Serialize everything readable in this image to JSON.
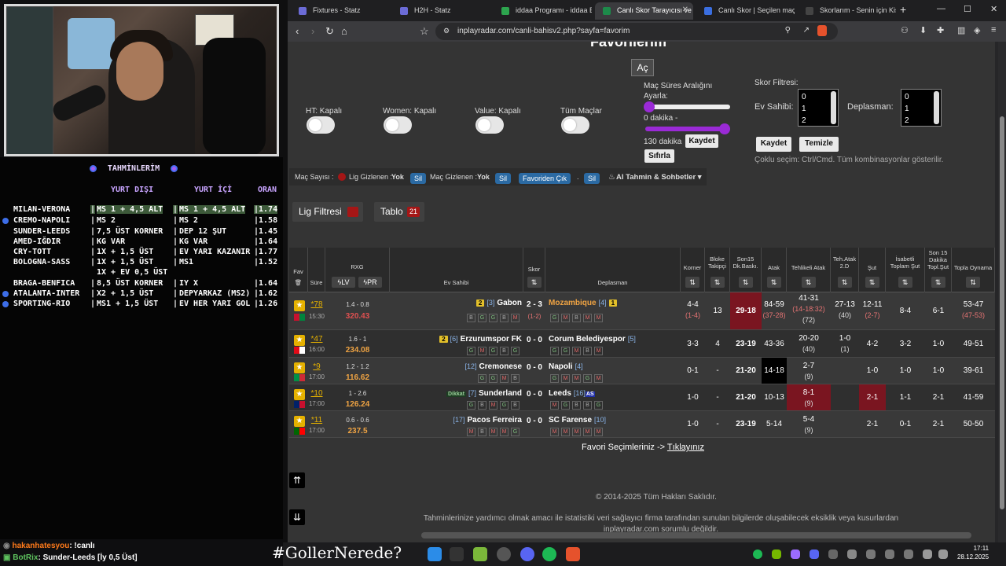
{
  "predictions": {
    "title": "TAHMİNLERİM",
    "headers": {
      "dis": "YURT DIŞI",
      "ic": "YURT İÇİ",
      "oran": "ORAN"
    },
    "rows": [
      {
        "match": "MILAN-VERONA",
        "dis": "MS 1 + 4,5 ALT",
        "ic": "MS 1 + 4,5 ALT",
        "oran": "|1.74",
        "hl": true,
        "bullet": false
      },
      {
        "match": "CREMO-NAPOLI",
        "dis": "MS 2",
        "ic": "MS 2",
        "oran": "|1.58",
        "hl": false,
        "bullet": true
      },
      {
        "match": "SUNDER-LEEDS",
        "dis": "7,5 ÜST KORNER",
        "ic": "DEP 12 ŞUT",
        "oran": "|1.45",
        "hl": false,
        "bullet": false
      },
      {
        "match": "AMED-IĞDIR",
        "dis": "KG VAR",
        "ic": "KG VAR",
        "oran": "|1.64",
        "hl": false,
        "bullet": false
      },
      {
        "match": "CRY-TOTT",
        "dis": "1X + 1,5 ÜST",
        "ic": "EV YARI KAZANIR",
        "oran": "|1.77",
        "hl": false,
        "bullet": false
      },
      {
        "match": "BOLOGNA-SASS",
        "dis": "1X + 1,5 ÜST",
        "ic": "MS1",
        "oran": "|1.52",
        "hl": false,
        "bullet": false
      },
      {
        "match": "",
        "dis": "1X + EV 0,5 ÜST",
        "ic": "",
        "oran": "",
        "hl": false,
        "bullet": false
      },
      {
        "match": "BRAGA-BENFICA",
        "dis": "8,5 ÜST KORNER",
        "ic": "IY X",
        "oran": "|1.64",
        "hl": false,
        "bullet": false
      },
      {
        "match": "ATALANTA-INTER",
        "dis": "X2 + 1,5 ÜST",
        "ic": "DEPYARKAZ (MS2)",
        "oran": "|1.62",
        "hl": false,
        "bullet": true
      },
      {
        "match": "SPORTING-RIO",
        "dis": "MS1 + 1,5 ÜST",
        "ic": "EV HER YARI GOL",
        "oran": "|1.26",
        "hl": false,
        "bullet": true
      }
    ]
  },
  "chat": [
    {
      "user": "hakanhatesyou",
      "msg": ": !canlı",
      "color": "#ff7a1a"
    },
    {
      "user": "BotRix",
      "msg": ": Sunder-Leeds [İy 0,5 Üst]",
      "color": "#5ec25e"
    }
  ],
  "browser": {
    "tabs": [
      "Fixtures - Statz",
      "H2H - Statz",
      "iddaa Programı - iddaa Bü",
      "Canlı Skor Tarayıcısı ve",
      "Canlı Skor | Seçilen maçlar",
      "Skorlarım - Senin için Kişise"
    ],
    "url": "inplayradar.com/canli-bahisv2.php?sayfa=favorim"
  },
  "page": {
    "title": "Favorilerim",
    "ac": "Aç",
    "toggles": [
      "HT: Kapalı",
      "Women: Kapalı",
      "Value: Kapalı",
      "Tüm Maçlar"
    ],
    "range_title": "Maç Süres Aralığını Ayarla:",
    "min_label": "0 dakika -",
    "max_label": "130 dakika",
    "kaydet_small": "Kaydet",
    "sifirla": "Sıfırla",
    "skor_filtresi": "Skor Filtresi:",
    "ev_sahibi": "Ev Sahibi:",
    "deplasman": "Deplasman:",
    "list_values": [
      "0",
      "1",
      "2"
    ],
    "kaydet": "Kaydet",
    "temizle": "Temizle",
    "coklu": "Çoklu seçim: Ctrl/Cmd. Tüm kombinasyonlar gösterilir.",
    "mac_sayisi": "Maç Sayısı :",
    "lig_gizlenen": "Lig Gizlenen :",
    "yok": "Yok",
    "sil": "Sil",
    "mac_gizlenen": "Maç Gizlenen :",
    "favoriden_cik": "Favoriden Çık",
    "ai": "AI Tahmin & Sohbetler ▾",
    "lig_filtresi": "Lig Filtresi",
    "tablo": "Tablo",
    "tablo_count": "21",
    "footer_link_text": "Favori Seçimleriniz ->",
    "footer_link": "Tıklayınız",
    "copyright": "© 2014-2025 Tüm Hakları Saklıdır.",
    "disclaimer": "Tahminlerinize yardımcı olmak amacı ile istatistiki veri sağlayıcı firma tarafından sunulan bilgilerde oluşabilecek eksiklik veya kusurlardan inplayradar.com sorumlu değildir."
  },
  "table": {
    "headers": {
      "fav": "Fav",
      "sure": "Süre",
      "rxg": "RXG",
      "lv": "LV",
      "pr": "PR",
      "ev": "Ev Sahibi",
      "skor": "Skor",
      "dep": "Deplasman",
      "korner": "Korner",
      "bloke": "Bloke Takipçi",
      "son15": "Son15 Dk.Baskı.",
      "atak": "Atak",
      "tehlikeli": "Tehlikeli Atak",
      "tehatak": "Teh.Atak 2.D",
      "sut": "Şut",
      "isabetli": "İsabetli Toplam Şut",
      "son15sut": "Son 15 Dakika Topl.Şut",
      "topla": "Topla Oynama"
    },
    "rows": [
      {
        "min": "*78",
        "time": "15:30",
        "rxg": "1.4 - 0.8",
        "val": "320.43",
        "valred": true,
        "home": "Gabon",
        "hrank": "[3]",
        "hbadge": "2",
        "away": "Mozambique",
        "arank": "[4]",
        "abadge": "1",
        "awayorange": true,
        "score": "2 - 3",
        "ht": "(1-2)",
        "hform": [
          "B",
          "G",
          "G",
          "B",
          "M"
        ],
        "aform": [
          "G",
          "M",
          "B",
          "M",
          "M"
        ],
        "korner": "4-4",
        "korner2": "(1-4)",
        "bloke": "13",
        "son15": "29-18",
        "atak": "84-59",
        "atak2": "(37-28)",
        "teh": "41-31",
        "teh2": "(14-18:32)",
        "teh3": "(72)",
        "tehatak": "27-13",
        "tehatak2": "(40)",
        "sut": "12-11",
        "sut2": "(2-7)",
        "isabetli": "8-4",
        "son15sut": "6-1",
        "topla": "53-47",
        "topla2": "(47-53)",
        "flag": [
          "#c8102e",
          "#00843d"
        ]
      },
      {
        "min": "*47",
        "time": "16:00",
        "rxg": "1.6 - 1",
        "val": "234.08",
        "valred": false,
        "home": "Erzurumspor FK",
        "hrank": "[6]",
        "hbadge": "2",
        "away": "Corum Belediyespor",
        "arank": "[5]",
        "abadge": "",
        "awayorange": false,
        "score": "0 - 0",
        "ht": "",
        "hform": [
          "G",
          "M",
          "G",
          "B",
          "G"
        ],
        "aform": [
          "G",
          "G",
          "M",
          "B",
          "M"
        ],
        "korner": "3-3",
        "korner2": "",
        "bloke": "4",
        "son15": "23-19",
        "atak": "43-36",
        "atak2": "",
        "teh": "20-20",
        "teh2": "(40)",
        "teh3": "",
        "tehatak": "1-0",
        "tehatak2": "(1)",
        "sut": "4-2",
        "sut2": "",
        "isabetli": "3-2",
        "son15sut": "1-0",
        "topla": "49-51",
        "topla2": "",
        "flag": [
          "#e30a17",
          "#ffffff"
        ]
      },
      {
        "min": "*9",
        "time": "17:00",
        "rxg": "1.2 - 1.2",
        "val": "116.62",
        "valred": false,
        "home": "Cremonese",
        "hrank": "[12]",
        "hbadge": "",
        "away": "Napoli",
        "arank": "[4]",
        "abadge": "",
        "awayorange": false,
        "score": "0 - 0",
        "ht": "",
        "hform": [
          "G",
          "G",
          "M",
          "B"
        ],
        "aform": [
          "G",
          "M",
          "M",
          "G",
          "M"
        ],
        "korner": "0-1",
        "korner2": "",
        "bloke": "-",
        "son15": "21-20",
        "atak": "14-18",
        "atak2": "",
        "teh": "2-7",
        "teh2": "(9)",
        "teh3": "",
        "tehatak": "",
        "tehatak2": "",
        "sut": "1-0",
        "sut2": "",
        "isabetli": "1-0",
        "son15sut": "1-0",
        "topla": "39-61",
        "topla2": "",
        "flag": [
          "#009246",
          "#ce2b37"
        ]
      },
      {
        "min": "*10",
        "time": "17:00",
        "rxg": "1 - 2.6",
        "val": "126.24",
        "valred": false,
        "home": "Sunderland",
        "hrank": "[7]",
        "hbadge": "",
        "away": "Leeds",
        "arank": "[16]",
        "abadge": "",
        "awayorange": false,
        "score": "0 - 0",
        "ht": "",
        "hform": [
          "G",
          "B",
          "M",
          "G",
          "B"
        ],
        "aform": [
          "M",
          "G",
          "B",
          "B",
          "G"
        ],
        "korner": "1-0",
        "korner2": "",
        "bloke": "-",
        "son15": "21-20",
        "atak": "10-13",
        "atak2": "",
        "teh": "8-1",
        "teh2": "(9)",
        "teh3": "",
        "tehatak": "",
        "tehatak2": "",
        "sut": "2-1",
        "sut2": "",
        "isabetli": "1-1",
        "son15sut": "2-1",
        "topla": "41-59",
        "topla2": "",
        "flag": [
          "#012169",
          "#c8102e"
        ],
        "dikkat": "Dikkat",
        "as": "AS"
      },
      {
        "min": "*11",
        "time": "17:00",
        "rxg": "0.6 - 0.6",
        "val": "237.5",
        "valred": false,
        "home": "Pacos Ferreira",
        "hrank": "[17]",
        "hbadge": "",
        "away": "SC Farense",
        "arank": "[10]",
        "abadge": "",
        "awayorange": false,
        "score": "0 - 0",
        "ht": "",
        "hform": [
          "M",
          "B",
          "M",
          "M",
          "G"
        ],
        "aform": [
          "M",
          "M",
          "M",
          "M",
          "M"
        ],
        "korner": "1-0",
        "korner2": "",
        "bloke": "-",
        "son15": "23-19",
        "atak": "5-14",
        "atak2": "",
        "teh": "5-4",
        "teh2": "(9)",
        "teh3": "",
        "tehatak": "",
        "tehatak2": "",
        "sut": "2-1",
        "sut2": "",
        "isabetli": "0-1",
        "son15sut": "2-1",
        "topla": "50-50",
        "topla2": "",
        "flag": [
          "#006600",
          "#ff0000"
        ]
      }
    ]
  },
  "taskbar": {
    "hashtag": "#GollerNerede?",
    "time": "17:11",
    "date": "28.12.2025"
  }
}
